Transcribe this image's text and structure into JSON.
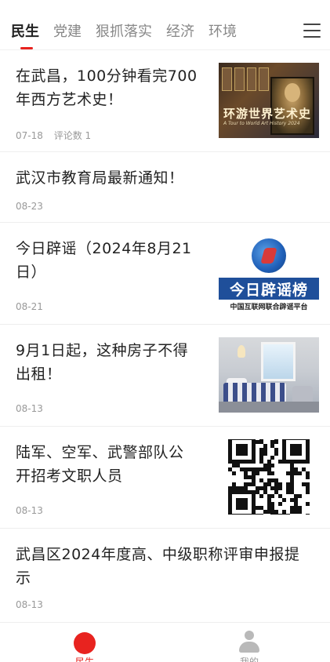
{
  "tabs": {
    "items": [
      {
        "label": "民生",
        "active": true
      },
      {
        "label": "党建",
        "active": false
      },
      {
        "label": "狠抓落实",
        "active": false
      },
      {
        "label": "经济",
        "active": false
      },
      {
        "label": "环境",
        "active": false
      }
    ],
    "menu_icon": "hamburger-menu-icon",
    "accent_color": "#e8231f"
  },
  "news": [
    {
      "title_line1": "在武昌，100分钟看完700",
      "title_line2": "年西方艺术史！",
      "date": "07-18",
      "comments": "评论数 1",
      "thumb": {
        "type": "art",
        "title": "环游世界艺术史",
        "subtitle": "A Tour to World Art History 2024"
      }
    },
    {
      "title_line1": "武汉市教育局最新通知！",
      "title_line2": "",
      "date": "08-23",
      "comments": ""
    },
    {
      "title_line1": "今日辟谣（2024年8月21",
      "title_line2": "日）",
      "date": "08-21",
      "comments": "",
      "thumb": {
        "type": "rumor",
        "banner": "今日辟谣榜",
        "caption": "中国互联网联合辟谣平台"
      }
    },
    {
      "title_line1": "9月1日起，这种房子不得",
      "title_line2": "出租！",
      "date": "08-13",
      "comments": "",
      "thumb": {
        "type": "room"
      }
    },
    {
      "title_line1": "陆军、空军、武警部队公",
      "title_line2": "开招考文职人员",
      "date": "08-13",
      "comments": "",
      "thumb": {
        "type": "qrcode"
      }
    },
    {
      "title_line1": "武昌区2024年度高、中级职称评审申报提",
      "title_line2": "示",
      "date": "08-13",
      "comments": ""
    }
  ],
  "bottom_nav": {
    "items": [
      {
        "label": "民生",
        "icon": "red-dot-icon",
        "active": true
      },
      {
        "label": "我的",
        "icon": "person-icon",
        "active": false
      }
    ]
  }
}
